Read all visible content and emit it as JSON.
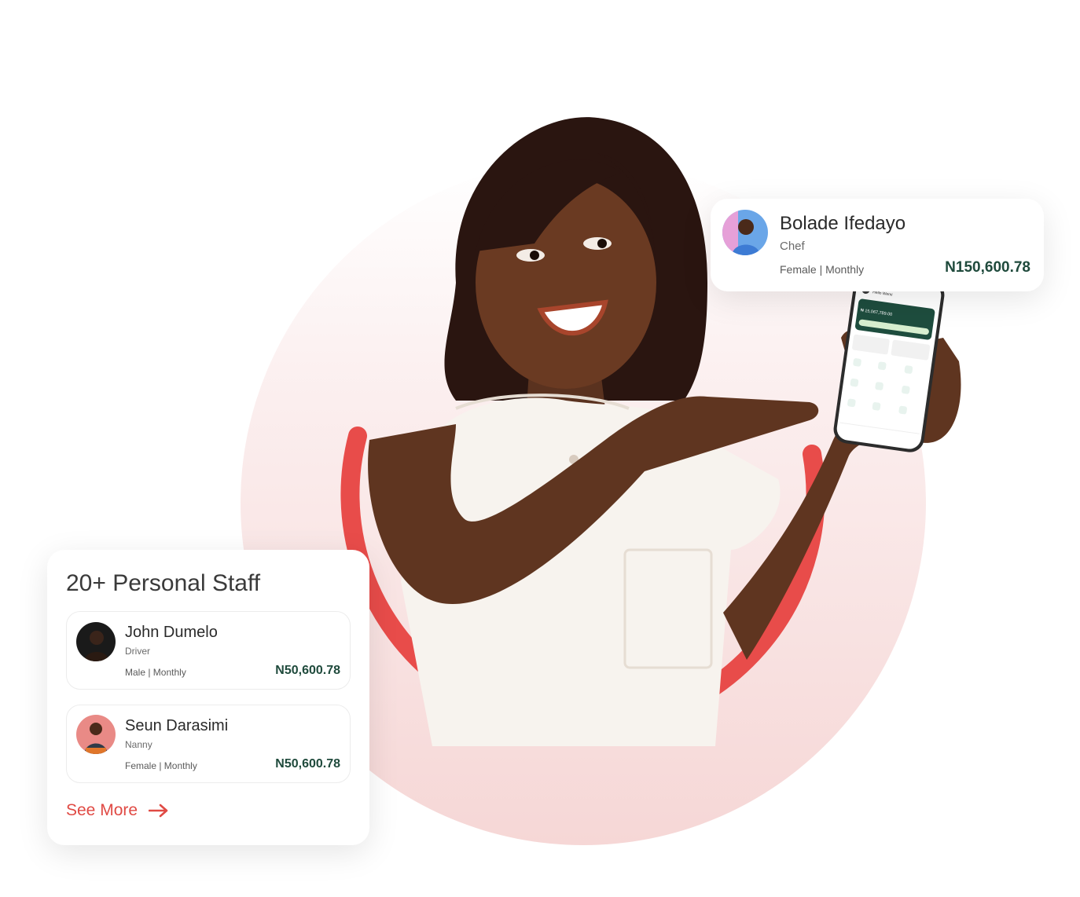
{
  "featured_staff": {
    "name": "Bolade Ifedayo",
    "role": "Chef",
    "meta": "Female | Monthly",
    "amount": "N150,600.78"
  },
  "staff_list": {
    "title": "20+ Personal Staff",
    "items": [
      {
        "name": "John Dumelo",
        "role": "Driver",
        "meta": "Male | Monthly",
        "amount": "N50,600.78"
      },
      {
        "name": "Seun Darasimi",
        "role": "Nanny",
        "meta": "Female | Monthly",
        "amount": "N50,600.78"
      }
    ],
    "see_more_label": "See More"
  },
  "phone_app": {
    "greeting": "Hello Wemi",
    "balance": "₦ 15,067,789.00"
  },
  "colors": {
    "accent_red": "#e84c4a",
    "amount_green": "#1f4a3c",
    "app_green": "#1e4d3e"
  },
  "icons": [
    "arrow-right-icon"
  ]
}
